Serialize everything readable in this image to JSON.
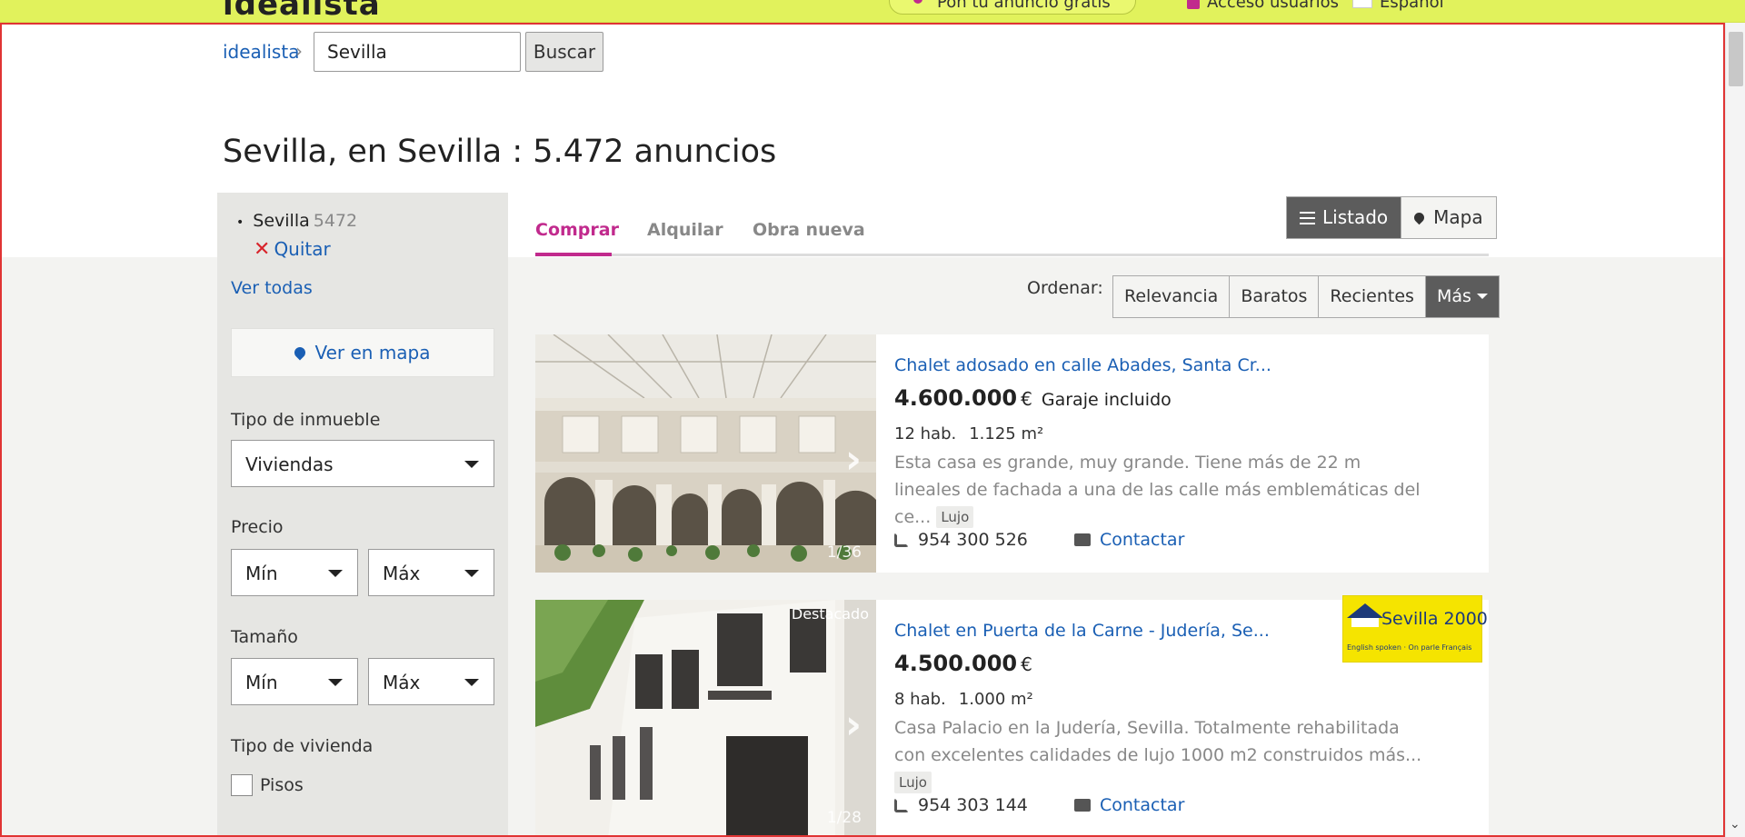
{
  "topbar": {
    "logo": "idealista",
    "pill_label": "Pon tu anuncio gratis",
    "user_link": "Acceso usuarios",
    "language": "Español"
  },
  "breadcrumb": {
    "home": "idealista",
    "separator": "›"
  },
  "search": {
    "value": "Sevilla",
    "button": "Buscar"
  },
  "page_title": "Sevilla, en Sevilla : 5.472 anuncios",
  "sidebar": {
    "location": {
      "name": "Sevilla",
      "count": "5472",
      "remove": "Quitar"
    },
    "see_all": "Ver todas",
    "see_map": "Ver en mapa",
    "property_type": {
      "label": "Tipo de inmueble",
      "value": "Viviendas"
    },
    "price": {
      "label": "Precio",
      "min": "Mín",
      "max": "Máx"
    },
    "size": {
      "label": "Tamaño",
      "min": "Mín",
      "max": "Máx"
    },
    "housing_type": {
      "label": "Tipo de vivienda",
      "option": "Pisos"
    }
  },
  "tabs": [
    {
      "label": "Comprar",
      "active": true
    },
    {
      "label": "Alquilar",
      "active": false
    },
    {
      "label": "Obra nueva",
      "active": false
    }
  ],
  "view_toggle": {
    "list": "Listado",
    "map": "Mapa",
    "active": "list"
  },
  "ordering": {
    "label": "Ordenar:",
    "options": [
      "Relevancia",
      "Baratos",
      "Recientes",
      "Más"
    ],
    "active": "Más"
  },
  "listings": [
    {
      "title": "Chalet adosado en calle Abades, Santa Cr...",
      "price": "4.600.000",
      "currency": "€",
      "extra": "Garaje incluido",
      "rooms": "12 hab.",
      "size": "1.125 m²",
      "description": "Esta casa es grande, muy grande. Tiene más de 22 m lineales de fachada a una de las calle más emblemáticas del ce...",
      "badge": "Lujo",
      "phone": "954 300 526",
      "contact": "Contactar",
      "photo_count": "1/36",
      "highlight": ""
    },
    {
      "title": "Chalet en Puerta de la Carne - Judería, Se...",
      "price": "4.500.000",
      "currency": "€",
      "extra": "",
      "rooms": "8 hab.",
      "size": "1.000 m²",
      "description": "Casa Palacio en la Judería, Sevilla. Totalmente rehabilitada con excelentes calidades de lujo 1000 m2 construidos más...",
      "badge": "Lujo",
      "phone": "954 303 144",
      "contact": "Contactar",
      "photo_count": "1/28",
      "highlight": "Destacado",
      "agency": {
        "name": "Sevilla 2000",
        "line": "English spoken · On parle Français"
      }
    }
  ],
  "colors": {
    "brand_yellow": "#e1f25c",
    "accent_magenta": "#c12a8d",
    "link_blue": "#1a5fb4"
  }
}
